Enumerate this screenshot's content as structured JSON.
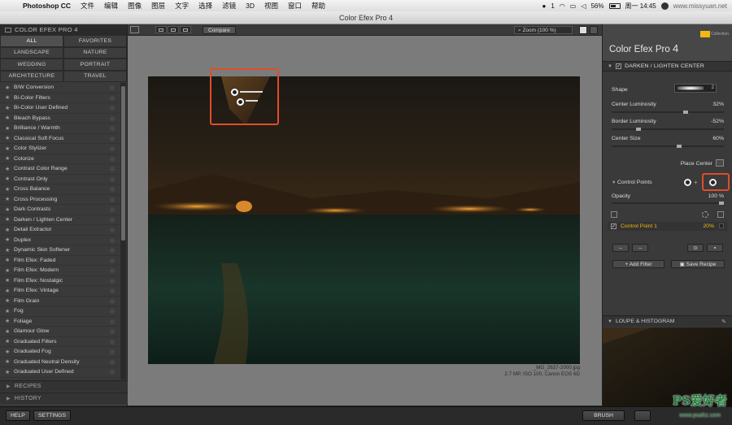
{
  "menubar": {
    "app_name": "Photoshop CC",
    "items": [
      "文件",
      "编辑",
      "图像",
      "图层",
      "文字",
      "选择",
      "滤镜",
      "3D",
      "视图",
      "窗口",
      "帮助"
    ],
    "wechat_badge": "1",
    "battery": "56%",
    "clock": "周一 14:45",
    "overlay_site": "www.missyuan.net"
  },
  "window": {
    "title": "Color Efex Pro 4"
  },
  "left_panel": {
    "header": "COLOR EFEX PRO 4",
    "categories": [
      "ALL",
      "FAVORITES",
      "LANDSCAPE",
      "NATURE",
      "WEDDING",
      "PORTRAIT",
      "ARCHITECTURE",
      "TRAVEL"
    ],
    "filters": [
      "B/W Conversion",
      "Bi-Color Filters",
      "Bi-Color User Defined",
      "Bleach Bypass",
      "Brilliance / Warmth",
      "Classical Soft Focus",
      "Color Stylizer",
      "Colorize",
      "Contrast Color Range",
      "Contrast Only",
      "Cross Balance",
      "Cross Processing",
      "Dark Contrasts",
      "Darken / Lighten Center",
      "Detail Extractor",
      "Duplex",
      "Dynamic Skin Softener",
      "Film Efex: Faded",
      "Film Efex: Modern",
      "Film Efex: Nostalgic",
      "Film Efex: Vintage",
      "Film Grain",
      "Fog",
      "Foliage",
      "Glamour Glow",
      "Graduated Filters",
      "Graduated Fog",
      "Graduated Neutral Density",
      "Graduated User Defined"
    ],
    "recipes_label": "RECIPES",
    "history_label": "HISTORY"
  },
  "toolbar": {
    "compare_label": "Compare",
    "zoom_label": "Zoom (100 %)"
  },
  "canvas": {
    "filename": "_MG_2637-2000.jpg",
    "meta": "2.7 MP, ISO 100, Canon EOS 6D"
  },
  "right_panel": {
    "brand_title": "Color Efex Pro",
    "brand_version": "4",
    "brand_logo_text": "Collection",
    "section_title": "DARKEN / LIGHTEN CENTER",
    "shape_label": "Shape",
    "shape_value": "2",
    "sliders": [
      {
        "label": "Center Luminosity",
        "value": "32%",
        "level": 0.66
      },
      {
        "label": "Border Luminosity",
        "value": "-52%",
        "level": 0.24
      },
      {
        "label": "Center Size",
        "value": "60%",
        "level": 0.6
      }
    ],
    "place_center_label": "Place Center",
    "control_points_label": "Control Points",
    "opacity_label": "Opacity",
    "opacity_value": "100 %",
    "control_point": {
      "label": "Control Point 1",
      "value": "20%"
    },
    "add_filter_label": "Add Filter",
    "save_recipe_label": "Save Recipe",
    "loupe_label": "LOUPE & HISTOGRAM"
  },
  "bottom": {
    "help_label": "HELP",
    "settings_label": "SETTINGS",
    "brush_label": "BRUSH"
  },
  "watermark": {
    "text": "PS爱好者",
    "url": "www.psahz.com"
  },
  "colors": {
    "accent_yellow": "#f2b712",
    "highlight_red": "#e14c2a",
    "panel_bg": "#3a3a3a",
    "canvas_bg": "#7b7b7b"
  }
}
